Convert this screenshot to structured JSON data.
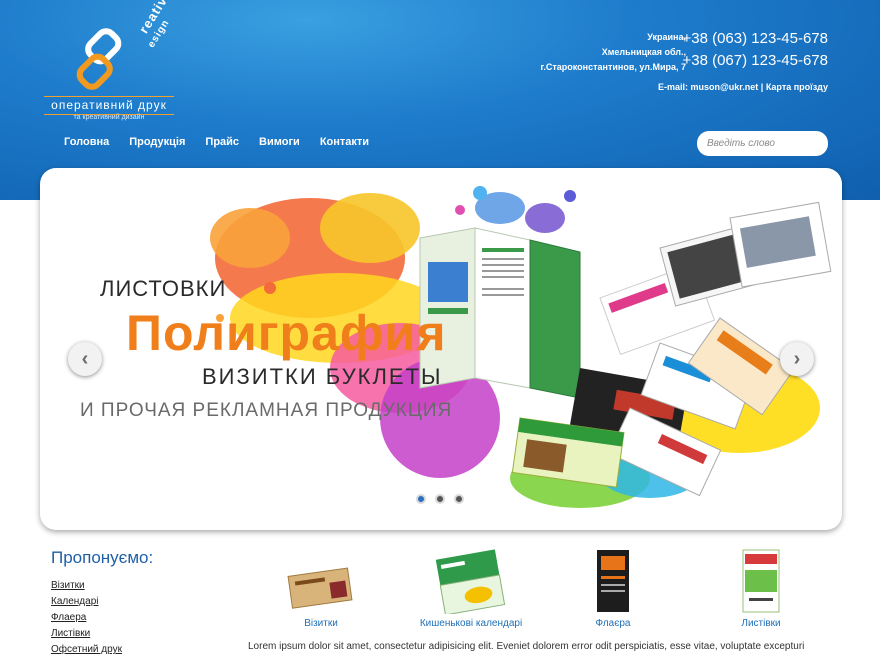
{
  "logo": {
    "side_text_1": "reative",
    "side_text_2": "esign",
    "title": "оперативний друк",
    "subtitle": "та креативний дизайн"
  },
  "contacts": {
    "address_lines": [
      "Украина,",
      "Хмельницкая обл.,",
      "г.Староконстантинов, ул.Мира, 7"
    ],
    "phone_1": "+38 (063) 123-45-678",
    "phone_2": "+38 (067) 123-45-678",
    "email": "E-mail: muson@ukr.net",
    "separator": " | ",
    "map_link": "Карта проїзду"
  },
  "nav": {
    "items": [
      "Головна",
      "Продукція",
      "Прайс",
      "Вимоги",
      "Контакти"
    ]
  },
  "search": {
    "placeholder": "Введіть слово",
    "value": ""
  },
  "slider": {
    "line_1": "ЛИСТОВКИ",
    "line_2": "Полиграфия",
    "line_3": "ВИЗИТКИ  БУКЛЕТЫ",
    "line_4": "И ПРОЧАЯ РЕКЛАМНАЯ ПРОДУКЦИЯ",
    "prev_icon": "‹",
    "next_icon": "›",
    "slide_count": 3,
    "active_slide": 1
  },
  "offer": {
    "title": "Пропонуємо:",
    "items": [
      "Візитки",
      "Календарі",
      "Флаера",
      "Листівки",
      "Офсетний друк"
    ]
  },
  "products": [
    {
      "label": "Візитки"
    },
    {
      "label": "Кишенькові календарі"
    },
    {
      "label": "Флаєра"
    },
    {
      "label": "Листівки"
    }
  ],
  "body_text": "Lorem ipsum dolor sit amet, consectetur adipisicing elit. Eveniet dolorem error odit perspiciatis, esse vitae, voluptate excepturi",
  "colors": {
    "header_blue": "#1e7ccc",
    "accent_orange": "#f07e1a",
    "link_blue": "#1f6fb8"
  }
}
